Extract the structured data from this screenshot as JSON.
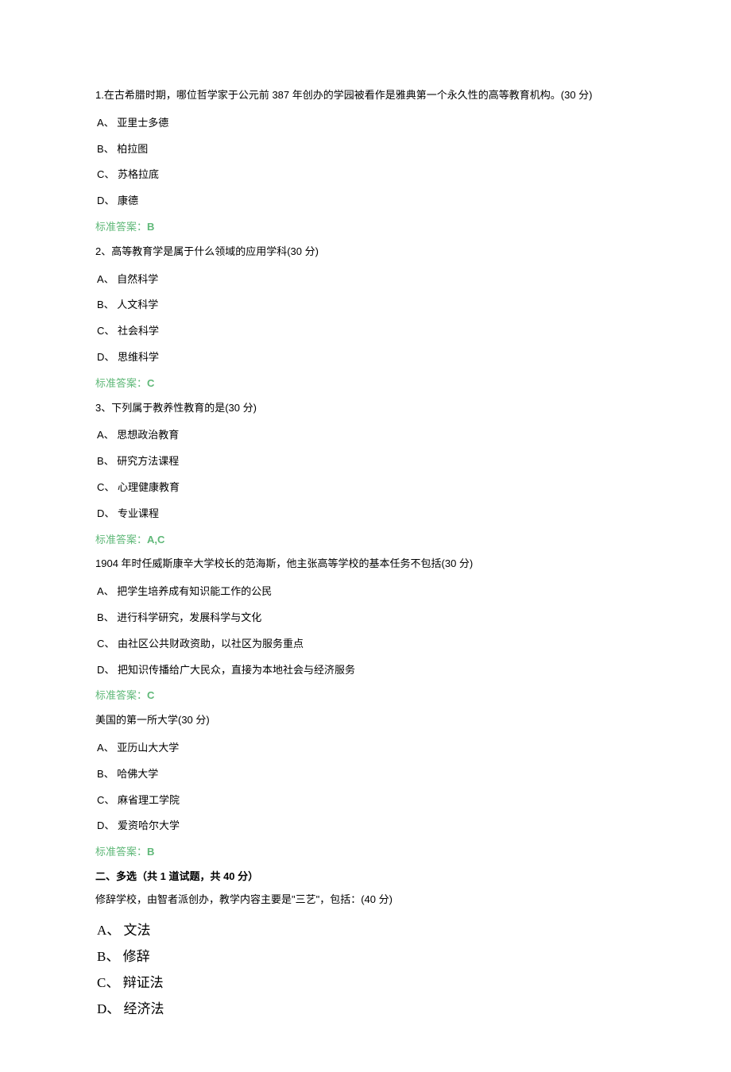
{
  "questions": [
    {
      "text": "1.在古希腊时期，哪位哲学家于公元前 387 年创办的学园被看作是雅典第一个永久性的高等教育机构。(30 分)",
      "options": [
        "A、 亚里士多德",
        "B、 柏拉图",
        "C、 苏格拉底",
        "D、 康德"
      ],
      "answer_label": "标准答案：",
      "answer_value": "B"
    },
    {
      "text": "2、高等教育学是属于什么领域的应用学科(30 分)",
      "options": [
        "A、 自然科学",
        "B、 人文科学",
        "C、 社会科学",
        "D、 思维科学"
      ],
      "answer_label": "标准答案：",
      "answer_value": "C"
    },
    {
      "text": "3、下列属于教养性教育的是(30 分)",
      "options": [
        "A、 思想政治教育",
        "B、 研究方法课程",
        "C、 心理健康教育",
        "D、 专业课程"
      ],
      "answer_label": "标准答案：",
      "answer_value": "A,C"
    },
    {
      "text": "1904 年时任威斯康辛大学校长的范海斯，他主张高等学校的基本任务不包括(30 分)",
      "options": [
        "A、 把学生培养成有知识能工作的公民",
        "B、 进行科学研究，发展科学与文化",
        "C、 由社区公共财政资助，以社区为服务重点",
        "D、 把知识传播给广大民众，直接为本地社会与经济服务"
      ],
      "answer_label": "标准答案：",
      "answer_value": "C"
    },
    {
      "text": "美国的第一所大学(30 分)",
      "options": [
        "A、 亚历山大大学",
        "B、 哈佛大学",
        "C、 麻省理工学院",
        "D、 爱资哈尔大学"
      ],
      "answer_label": "标准答案：",
      "answer_value": "B"
    }
  ],
  "section2": {
    "header": "二、多选（共 1 道试题，共 40 分）",
    "text": "修辞学校，由智者派创办，教学内容主要是\"三艺\"，包括：(40 分)",
    "options": [
      "A、 文法",
      "B、 修辞",
      "C、 辩证法",
      "D、 经济法"
    ]
  }
}
